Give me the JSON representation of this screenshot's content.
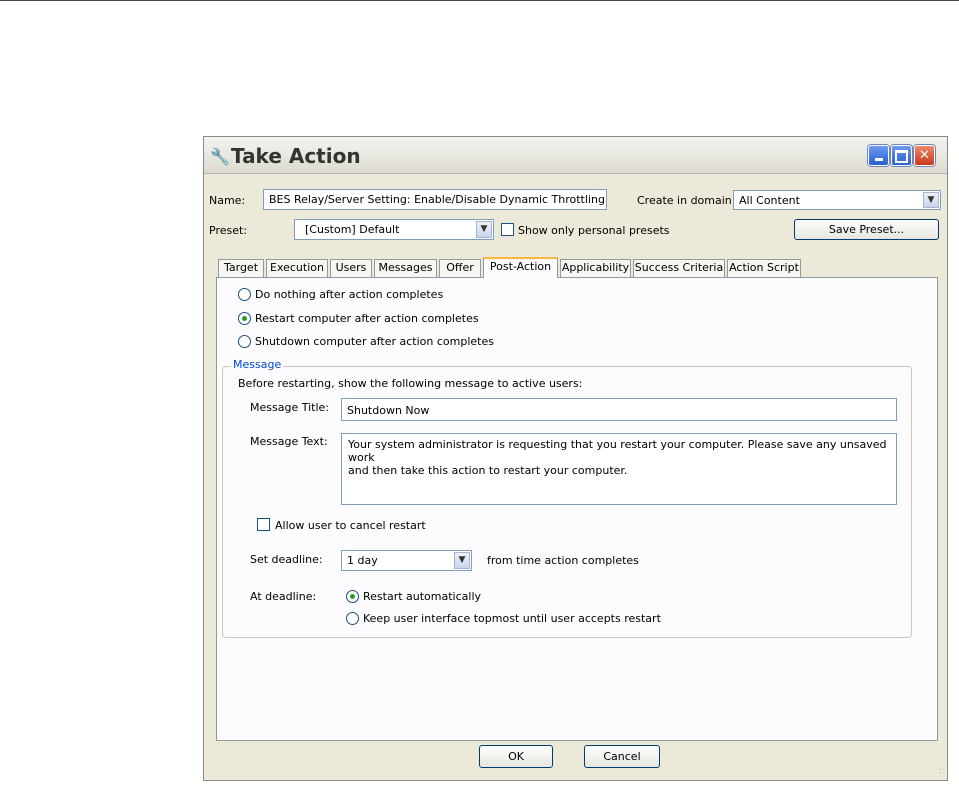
{
  "window": {
    "title": "Take Action",
    "icon": "wrench-icon"
  },
  "header": {
    "name_label": "Name:",
    "name_value": "BES Relay/Server Setting: Enable/Disable Dynamic Throttling",
    "domain_label": "Create in domain:",
    "domain_value": "All Content",
    "preset_label": "Preset:",
    "preset_value": "[Custom] Default",
    "personal_presets_label": "Show only personal presets",
    "save_preset_label": "Save Preset..."
  },
  "tabs": [
    {
      "label": "Target"
    },
    {
      "label": "Execution"
    },
    {
      "label": "Users"
    },
    {
      "label": "Messages"
    },
    {
      "label": "Offer"
    },
    {
      "label": "Post-Action"
    },
    {
      "label": "Applicability"
    },
    {
      "label": "Success Criteria"
    },
    {
      "label": "Action Script"
    }
  ],
  "active_tab": "Post-Action",
  "post_action": {
    "options": [
      {
        "label": "Do nothing after action completes",
        "selected": false
      },
      {
        "label": "Restart computer after action completes",
        "selected": true
      },
      {
        "label": "Shutdown computer after action completes",
        "selected": false
      }
    ],
    "message_group_label": "Message",
    "intro": "Before restarting, show the following message to active users:",
    "title_label": "Message Title:",
    "title_value": "Shutdown Now",
    "text_label": "Message Text:",
    "text_value": "Your system administrator is requesting that you restart your computer.  Please save any unsaved work\nand then take this action to restart your computer.",
    "allow_cancel_label": "Allow user to cancel restart",
    "deadline_label": "Set deadline:",
    "deadline_value": "1 day",
    "deadline_suffix": "from time action completes",
    "at_deadline_label": "At deadline:",
    "at_deadline_options": [
      {
        "label": "Restart automatically",
        "selected": true
      },
      {
        "label": "Keep user interface topmost until user accepts restart",
        "selected": false
      }
    ]
  },
  "footer": {
    "ok_label": "OK",
    "cancel_label": "Cancel"
  }
}
